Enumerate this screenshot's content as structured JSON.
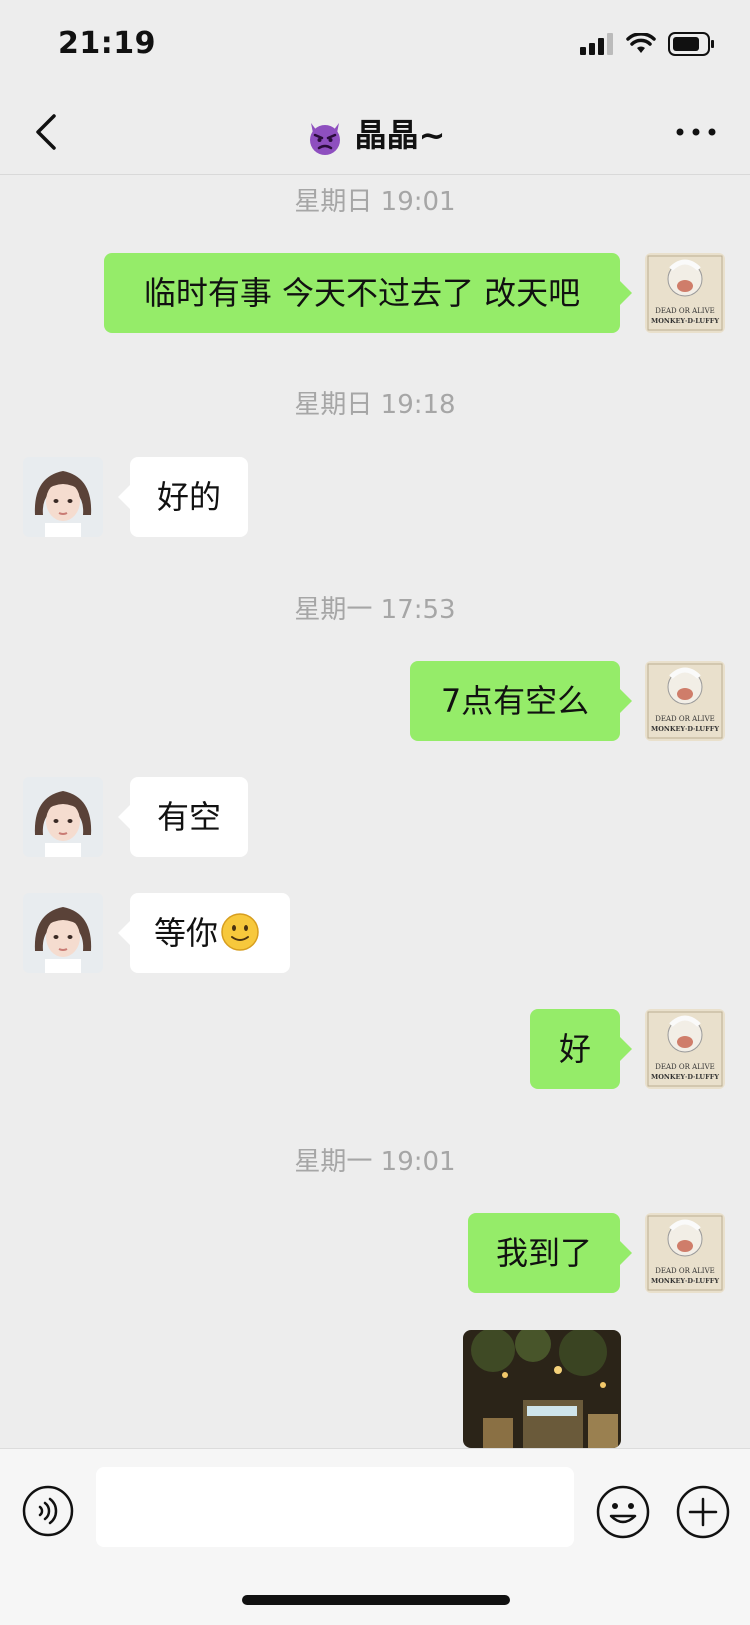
{
  "status": {
    "time": "21:19"
  },
  "header": {
    "title": "晶晶~"
  },
  "messages": [
    {
      "type": "timestamp",
      "text": "星期日 19:01"
    },
    {
      "type": "self",
      "text": "临时有事 今天不过去了 改天吧"
    },
    {
      "type": "timestamp",
      "text": "星期日 19:18"
    },
    {
      "type": "other",
      "text": "好的"
    },
    {
      "type": "timestamp",
      "text": "星期一 17:53"
    },
    {
      "type": "self",
      "text": "7点有空么"
    },
    {
      "type": "other",
      "text": "有空"
    },
    {
      "type": "other",
      "text": "等你"
    },
    {
      "type": "self",
      "text": "好"
    },
    {
      "type": "timestamp",
      "text": "星期一 19:01"
    },
    {
      "type": "self",
      "text": "我到了"
    }
  ],
  "avatar_self_text": {
    "line1": "DEAD OR ALIVE",
    "line2": "MONKEY·D·LUFFY"
  },
  "colors": {
    "self_bubble": "#95ec69",
    "other_bubble": "#ffffff",
    "background": "#ededed",
    "timestamp": "#a6a6a6"
  },
  "icons": [
    "back-icon",
    "devil-emoji-icon",
    "more-icon",
    "voice-icon",
    "emoji-icon",
    "plus-icon",
    "signal-icon",
    "wifi-icon",
    "battery-icon",
    "smile-emoji-icon"
  ]
}
